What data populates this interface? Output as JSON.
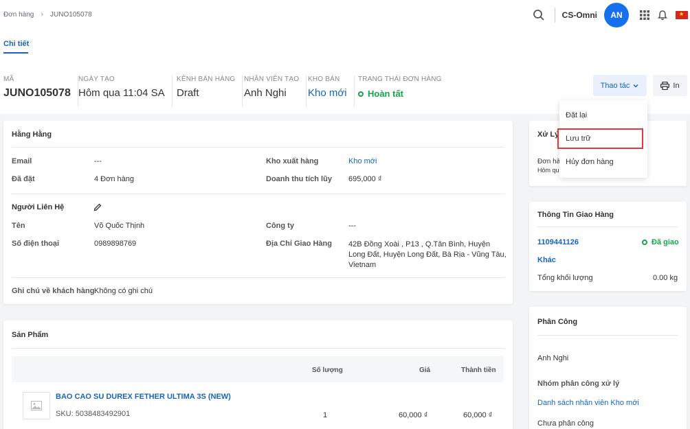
{
  "breadcrumb": {
    "root": "Đơn hàng",
    "current": "JUNO105078"
  },
  "header": {
    "brand": "CS-Omni",
    "avatar": "AN"
  },
  "tabs": {
    "detail": "Chi tiết"
  },
  "summary": {
    "code_label": "Mã",
    "code": "JUNO105078",
    "created_label": "Ngày tạo",
    "created": "Hôm qua 11:04 SA",
    "channel_label": "Kênh bán hàng",
    "channel": "Draft",
    "staff_label": "Nhân viên tạo",
    "staff": "Anh Nghi",
    "warehouse_label": "Kho bán",
    "warehouse": "Kho mới",
    "status_label": "Trạng thái đơn hàng",
    "status": "Hoàn tất"
  },
  "actions": {
    "menu": "Thao tác",
    "print": "In"
  },
  "dropdown": {
    "items": [
      "Đặt lại",
      "Lưu trữ",
      "Hủy đơn hàng"
    ]
  },
  "customer": {
    "name": "Hằng Hằng",
    "email_label": "Email",
    "email": "---",
    "orders_label": "Đã đặt",
    "orders": "4 Đơn hàng",
    "ship_wh_label": "Kho xuất hàng",
    "ship_wh": "Kho mới",
    "revenue_label": "Doanh thu tích lũy",
    "revenue": "695,000 ₫",
    "contact_title": "Người Liên Hệ",
    "cname_label": "Tên",
    "cname": "Võ Quốc Thịnh",
    "company_label": "Công ty",
    "company": "---",
    "phone_label": "Số điện thoại",
    "phone": "0989898769",
    "addr_label": "Địa Chỉ Giao Hàng",
    "addr_l1": "42B Đồng Xoài , P13 , Q.Tân Bình, Huyện",
    "addr_l2": "Long Đất, Huyện Long Đất, Bà Rịa - Vũng Tàu,",
    "addr_l3": "Vietnam",
    "note_label": "Ghi chú về khách hàng",
    "note": "Không có ghi chú"
  },
  "process": {
    "title": "Xử Lý",
    "line1": "Đơn hà",
    "line2": "Hôm qu"
  },
  "shipping": {
    "title": "Thông Tin Giao Hàng",
    "tracking": "1109441126",
    "status": "Đã giao",
    "carrier": "Khác",
    "weight_label": "Tổng khối lượng",
    "weight": "0.00 kg"
  },
  "products": {
    "title": "Sản Phẩm",
    "col_qty": "Số lượng",
    "col_price": "Giá",
    "col_total": "Thành tiền",
    "name": "BAO CAO SU DUREX FETHER ULTIMA 3S (NEW)",
    "sku": "SKU: 5038483492901",
    "qty": "1",
    "price": "60,000 ₫",
    "total": "60,000 ₫"
  },
  "assign": {
    "title": "Phân Công",
    "person": "Anh Nghi",
    "group_label": "Nhóm phân công xử lý",
    "group": "Danh sách nhân viên Kho mới",
    "unassigned": "Chưa phân công"
  }
}
